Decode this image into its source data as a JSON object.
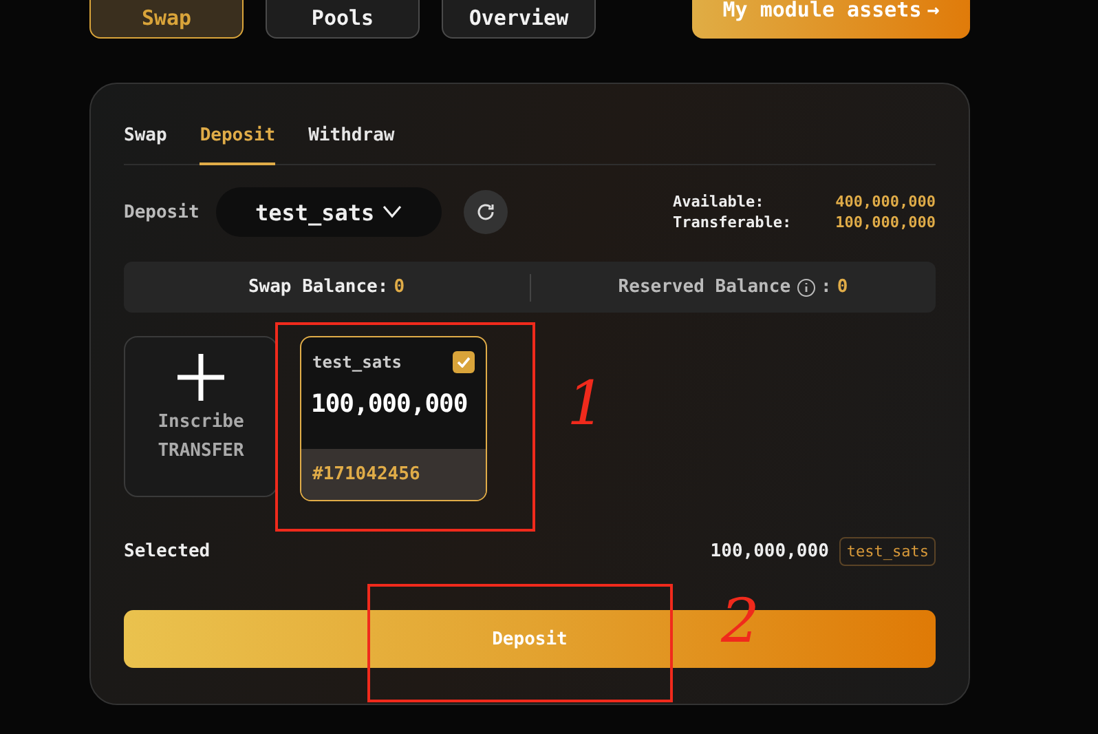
{
  "nav": [
    {
      "label": "Swap",
      "selected": true
    },
    {
      "label": "Pools",
      "selected": false
    },
    {
      "label": "Overview",
      "selected": false
    }
  ],
  "assets_button": {
    "label": "My module assets",
    "icon": "→"
  },
  "tabs": [
    {
      "label": "Swap",
      "selected": false
    },
    {
      "label": "Deposit",
      "selected": true
    },
    {
      "label": "Withdraw",
      "selected": false
    }
  ],
  "deposit": {
    "label": "Deposit",
    "token": "test_sats",
    "available_label": "Available:",
    "available": "400,000,000",
    "transferable_label": "Transferable:",
    "transferable": "100,000,000"
  },
  "balances": {
    "swap_label": "Swap Balance:",
    "swap": "0",
    "reserved_label": "Reserved Balance",
    "reserved_sep": ":",
    "reserved": "0"
  },
  "inscribe": {
    "line1": "Inscribe",
    "line2": "TRANSFER"
  },
  "inscriptions": [
    {
      "ticker": "test_sats",
      "amount": "100,000,000",
      "number": "#171042456",
      "checked": true
    }
  ],
  "selected": {
    "label": "Selected",
    "amount": "100,000,000",
    "ticker": "test_sats"
  },
  "submit": {
    "label": "Deposit"
  },
  "annotations": [
    {
      "label": "1"
    },
    {
      "label": "2"
    }
  ]
}
